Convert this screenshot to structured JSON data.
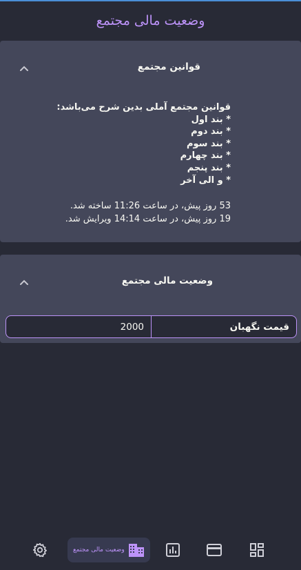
{
  "header": {
    "title": "وضعیت مالی مجتمع"
  },
  "rules_panel": {
    "title": "قوانین مجتمع",
    "content_lines": [
      "قوانین مجتمع آملی بدین شرح می‌باشد:",
      "* بند اول",
      "* بند دوم",
      "* بند سوم",
      "* بند چهارم",
      "* بند پنجم",
      "* و الی آخر"
    ],
    "created": "53 روز پیش، در ساعت 11:26 ساخته شد.",
    "edited": "19 روز پیش، در ساعت 14:14 ویرایش شد."
  },
  "finance_panel": {
    "title": "وضعیت مالی مجتمع",
    "field_label": "قیمت نگهبان",
    "field_value": "2000"
  },
  "bottom_nav": {
    "active_label": "وضعیت مالی مجتمع",
    "items": [
      "settings-icon",
      "building-icon",
      "chart-icon",
      "card-icon",
      "dashboard-icon"
    ]
  },
  "colors": {
    "background": "#282a36",
    "panel": "#44475a",
    "accent": "#bd93f9",
    "text": "#f8f8f2"
  }
}
